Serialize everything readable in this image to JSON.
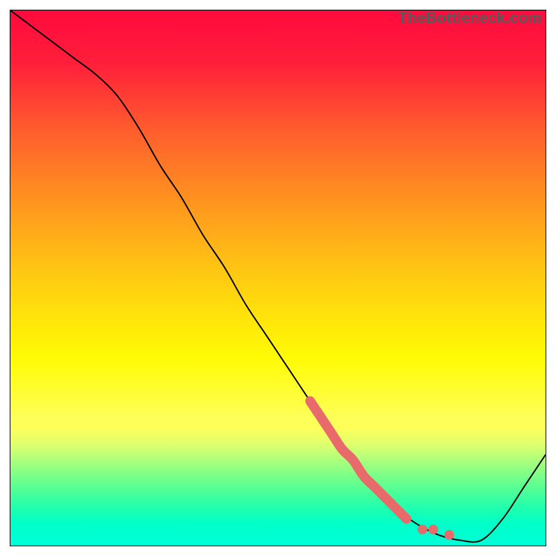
{
  "watermark": "TheBottleneck.com",
  "chart_data": {
    "type": "line",
    "title": "",
    "xlabel": "",
    "ylabel": "",
    "xlim": [
      0,
      100
    ],
    "ylim": [
      0,
      100
    ],
    "grid": false,
    "legend": false,
    "background": "rainbow-gradient-red-to-cyan-vertical",
    "series": [
      {
        "name": "bottleneck-curve",
        "color": "#000000",
        "x": [
          0,
          4,
          8,
          12,
          16,
          20,
          24,
          28,
          32,
          36,
          40,
          44,
          48,
          52,
          56,
          60,
          64,
          68,
          72,
          76,
          80,
          84,
          88,
          92,
          96,
          100
        ],
        "values": [
          100,
          97,
          94,
          91,
          88,
          84,
          78,
          71,
          65,
          58,
          52,
          45,
          39,
          33,
          27,
          21,
          16,
          11,
          7,
          4,
          2,
          1,
          1,
          5,
          11,
          17
        ]
      },
      {
        "name": "highlight-band",
        "color": "#e86a6a",
        "style": "thick-overlay",
        "x": [
          56,
          58,
          60,
          62,
          64,
          66,
          68,
          70,
          72,
          74
        ],
        "values": [
          27,
          24,
          21,
          18,
          16,
          13,
          11,
          9,
          7,
          5
        ]
      },
      {
        "name": "highlight-points",
        "color": "#e86a6a",
        "style": "scatter",
        "x": [
          74,
          77,
          79,
          82
        ],
        "values": [
          5,
          3,
          3,
          2
        ]
      }
    ]
  }
}
